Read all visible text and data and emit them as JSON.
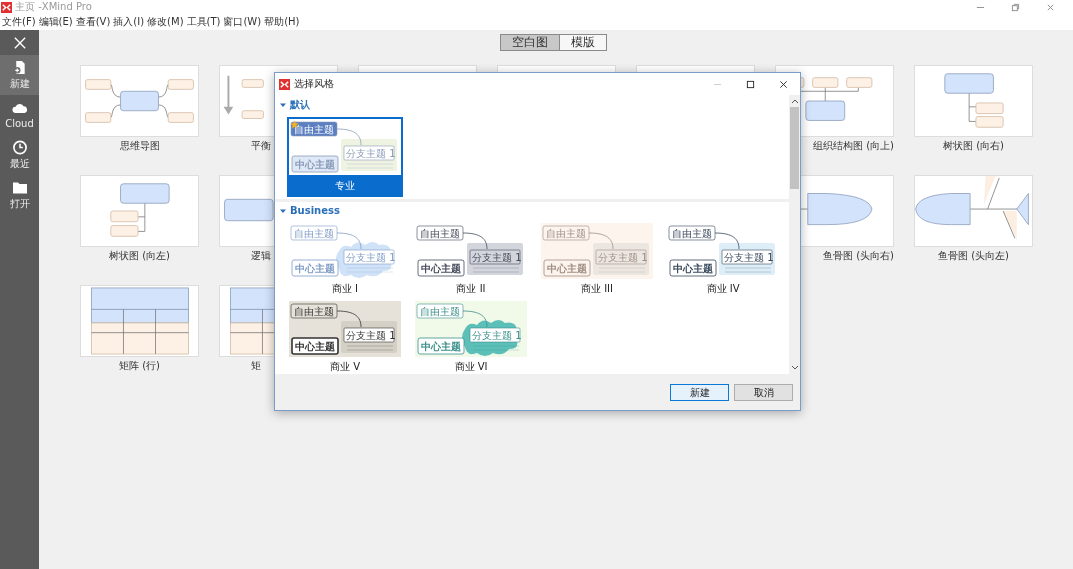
{
  "window": {
    "title": "主页 -XMind Pro"
  },
  "menu": [
    "文件(F)",
    "编辑(E)",
    "查看(V)",
    "插入(I)",
    "修改(M)",
    "工具(T)",
    "窗口(W)",
    "帮助(H)"
  ],
  "sidebar": [
    {
      "label": "新建",
      "kind": "new",
      "selected": true
    },
    {
      "label": "Cloud",
      "kind": "cloud",
      "selected": false
    },
    {
      "label": "最近",
      "kind": "recent",
      "selected": false
    },
    {
      "label": "打开",
      "kind": "open",
      "selected": false
    }
  ],
  "view_tabs": [
    {
      "label": "空白图",
      "selected": true
    },
    {
      "label": "模版",
      "selected": false
    }
  ],
  "templates": [
    [
      {
        "kind": "mindmap",
        "label": "思维导图"
      },
      {
        "kind": "balance",
        "label": "平衡"
      },
      {
        "kind": "blank"
      },
      {
        "kind": "blank"
      },
      {
        "kind": "blank"
      },
      {
        "kind": "org-up",
        "label": "组织结构图 (向上)"
      },
      {
        "kind": "tree-right",
        "label": "树状图 (向右)"
      }
    ],
    [
      {
        "kind": "tree-left",
        "label": "树状图 (向左)"
      },
      {
        "kind": "logic",
        "label": "逻辑"
      },
      {
        "kind": "hidden"
      },
      {
        "kind": "hidden"
      },
      {
        "kind": "hidden"
      },
      {
        "kind": "fishbone-right",
        "label": "鱼骨图 (头向右)"
      },
      {
        "kind": "fishbone-left",
        "label": "鱼骨图 (头向左)"
      }
    ],
    [
      {
        "kind": "matrix-row",
        "label": "矩阵 (行)"
      },
      {
        "kind": "matrix",
        "label": "矩"
      }
    ]
  ],
  "dialog": {
    "title": "选择风格",
    "sections": [
      {
        "title": "默认",
        "expanded": true,
        "styles": [
          {
            "label": "专业",
            "kind": "pro",
            "selected": true,
            "floating": "自由主题",
            "branch": "分支主题 1",
            "center": "中心主题"
          }
        ]
      },
      {
        "title": "Business",
        "expanded": true,
        "styles": [
          {
            "label": "商业 I",
            "kind": "cloud",
            "selected": false,
            "floating": "自由主题",
            "branch": "分支主题 1",
            "center": "中心主题"
          },
          {
            "label": "商业 II",
            "kind": "gray",
            "selected": false,
            "floating": "自由主题",
            "branch": "分支主题 1",
            "center": "中心主题"
          },
          {
            "label": "商业 III",
            "kind": "peach",
            "selected": false,
            "floating": "自由主题",
            "branch": "分支主题 1",
            "center": "中心主题"
          },
          {
            "label": "商业 IV",
            "kind": "light",
            "selected": false,
            "floating": "自由主题",
            "branch": "分支主题 1",
            "center": "中心主题"
          },
          {
            "label": "商业 V",
            "kind": "stone",
            "selected": false,
            "floating": "自由主题",
            "branch": "分支主题 1",
            "center": "中心主题"
          },
          {
            "label": "商业 VI",
            "kind": "teal",
            "selected": false,
            "floating": "自由主题",
            "branch": "分支主题 1",
            "center": "中心主题"
          }
        ]
      }
    ],
    "buttons": [
      {
        "label": "新建",
        "kind": "primary"
      },
      {
        "label": "取消",
        "kind": "secondary"
      }
    ]
  }
}
